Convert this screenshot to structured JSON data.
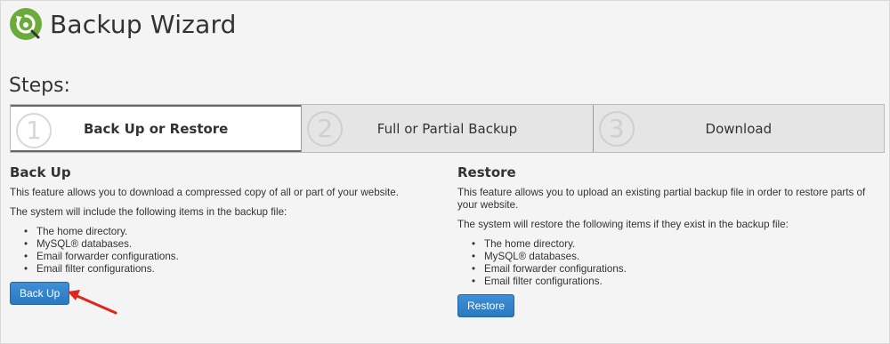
{
  "header": {
    "title": "Backup Wizard",
    "icon": "backup-restore-icon",
    "icon_color": "#6aab3b"
  },
  "steps": {
    "heading": "Steps:",
    "items": [
      {
        "number": "1",
        "label": "Back Up or Restore",
        "active": true
      },
      {
        "number": "2",
        "label": "Full or Partial Backup",
        "active": false
      },
      {
        "number": "3",
        "label": "Download",
        "active": false
      }
    ]
  },
  "backup": {
    "title": "Back Up",
    "description": "This feature allows you to download a compressed copy of all or part of your website.",
    "list_intro": "The system will include the following items in the backup file:",
    "items": [
      "The home directory.",
      "MySQL® databases.",
      "Email forwarder configurations.",
      "Email filter configurations."
    ],
    "button_label": "Back Up"
  },
  "restore": {
    "title": "Restore",
    "description": "This feature allows you to upload an existing partial backup file in order to restore parts of your website.",
    "list_intro": "The system will restore the following items if they exist in the backup file:",
    "items": [
      "The home directory.",
      "MySQL® databases.",
      "Email forwarder configurations.",
      "Email filter configurations."
    ],
    "button_label": "Restore"
  },
  "annotation": {
    "arrow_color": "#e0261b"
  },
  "colors": {
    "button_blue": "#2b79c0",
    "active_step_bg": "#ffffff",
    "inactive_step_bg": "#e5e5e5"
  }
}
